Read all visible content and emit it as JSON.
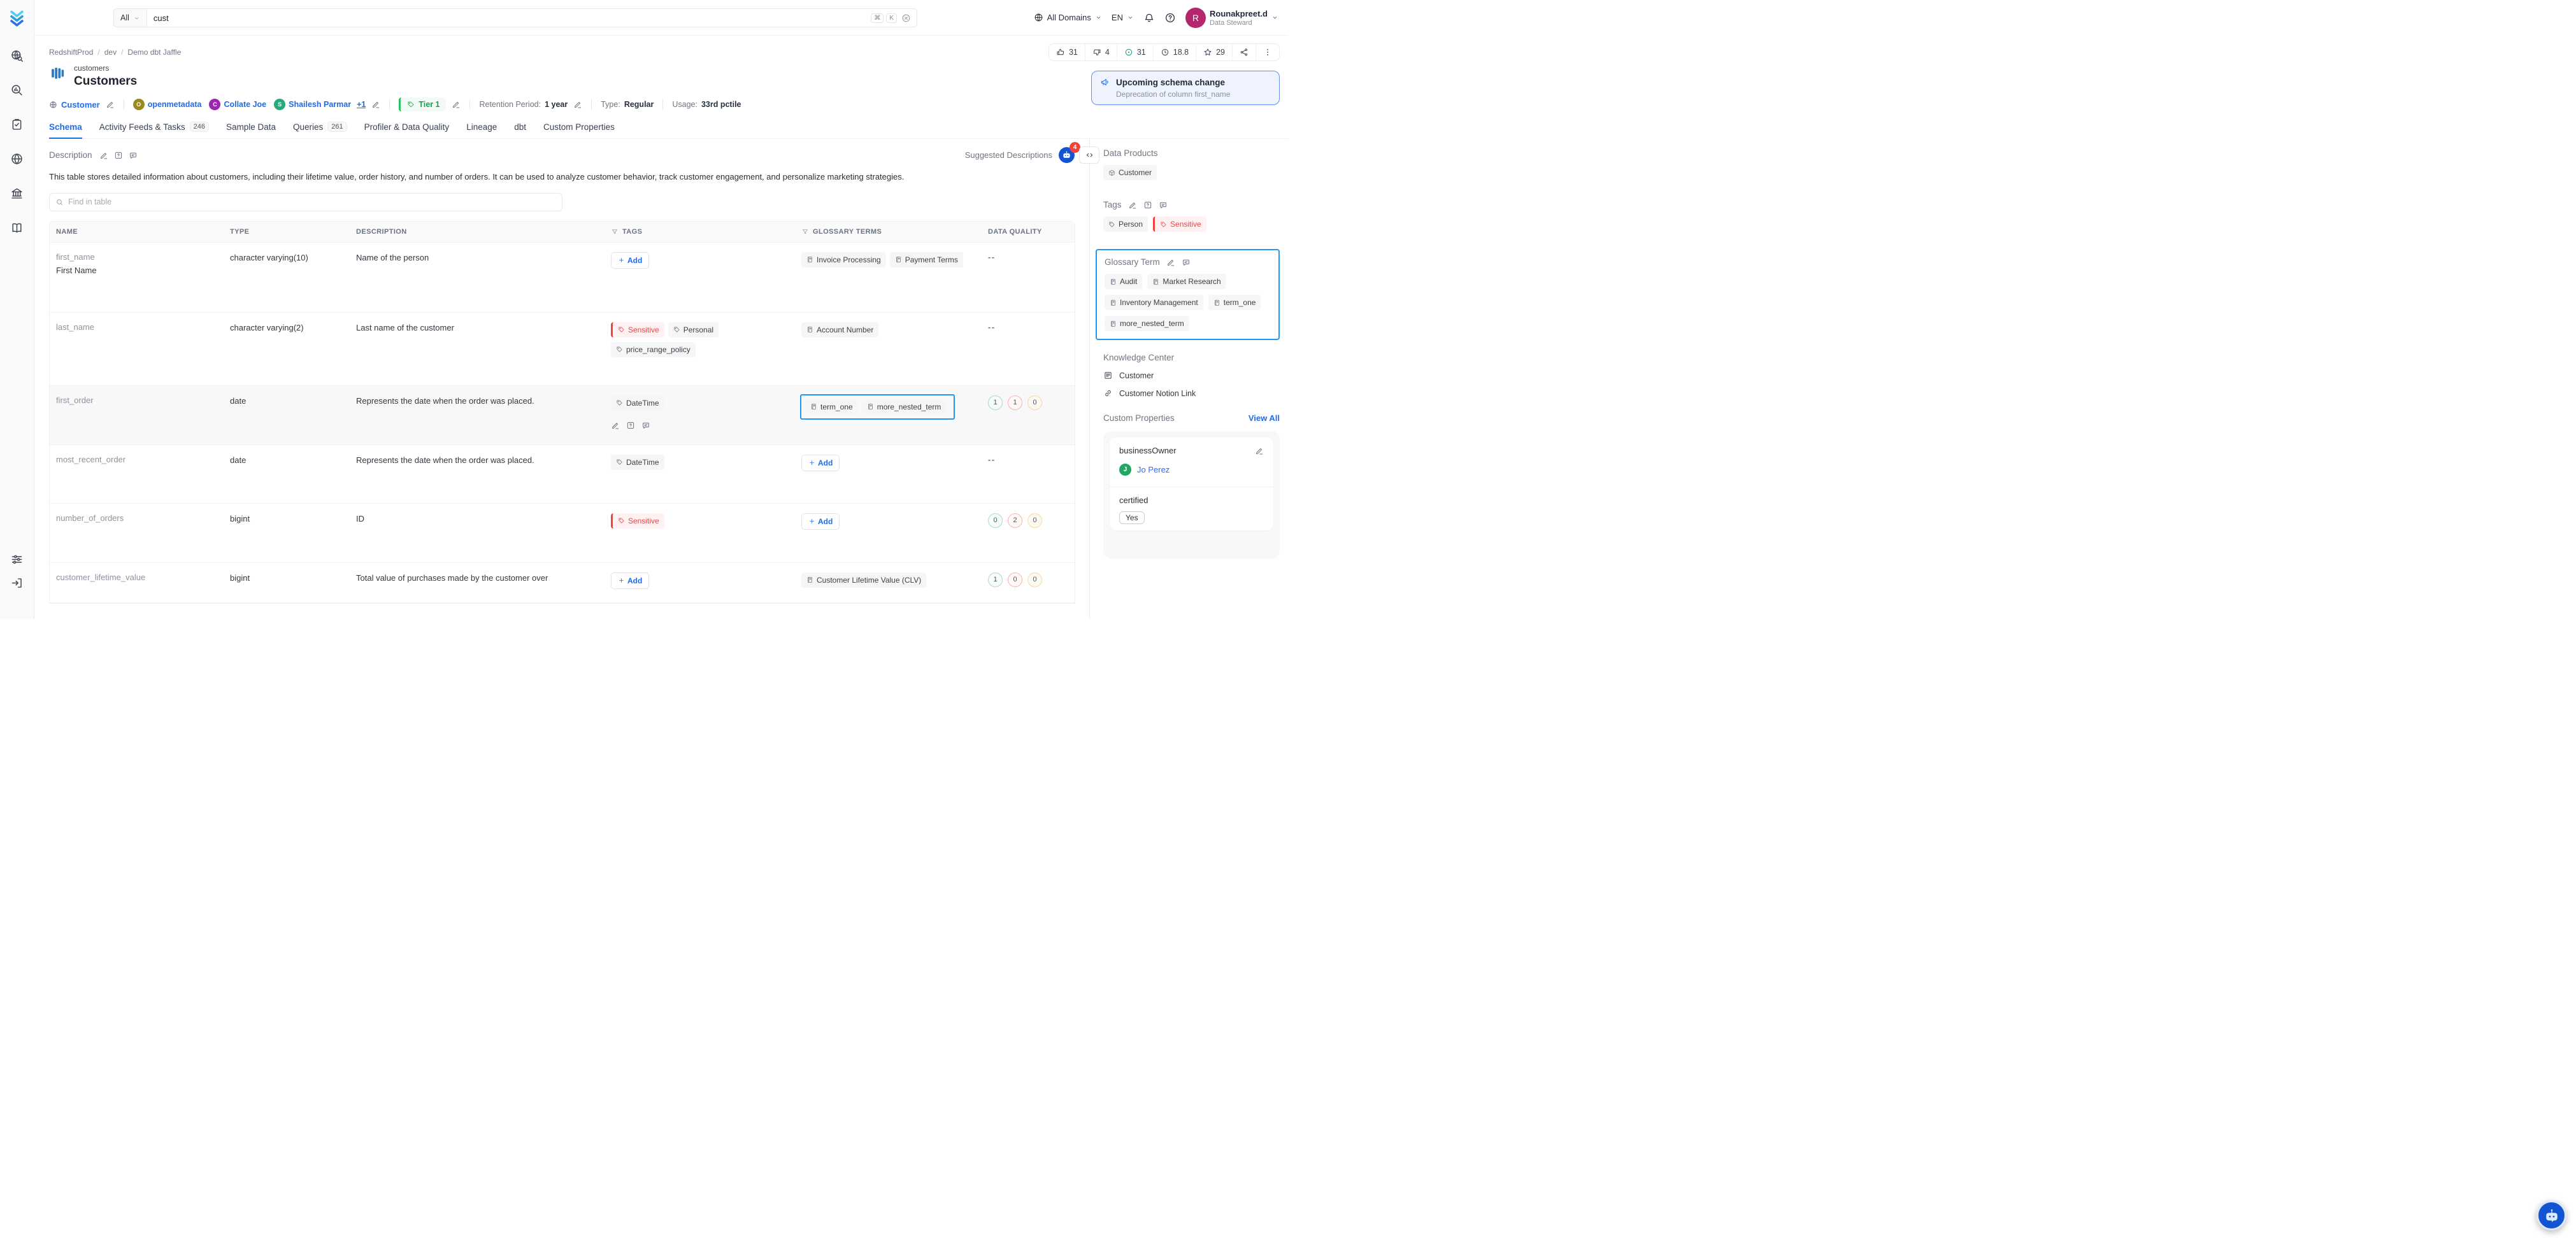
{
  "topbar": {
    "search": {
      "scope": "All",
      "value": "cust",
      "keys": [
        "⌘",
        "K"
      ]
    },
    "domain_selector": "All Domains",
    "language": "EN",
    "user": {
      "initial": "R",
      "name": "Rounakpreet.d",
      "role": "Data Steward"
    }
  },
  "leftnav": {
    "items": [
      "explore",
      "observability",
      "quality",
      "insights",
      "governance",
      "glossary"
    ],
    "bottom": [
      "settings",
      "logout"
    ]
  },
  "header": {
    "breadcrumb": [
      "RedshiftProd",
      "dev",
      "Demo dbt Jaffle"
    ],
    "entity_name": "customers",
    "entity_title": "Customers",
    "stats": [
      {
        "icon": "thumbs-up",
        "value": "31"
      },
      {
        "icon": "thumbs-down",
        "value": "4"
      },
      {
        "icon": "target",
        "value": "31",
        "accent": "teal"
      },
      {
        "icon": "clock",
        "value": "18.8"
      },
      {
        "icon": "star",
        "value": "29"
      },
      {
        "icon": "share"
      },
      {
        "icon": "more"
      }
    ],
    "meta": {
      "domain": "Customer",
      "owners": [
        {
          "initial": "O",
          "name": "openmetadata",
          "color": "#9a8a1d"
        },
        {
          "initial": "C",
          "name": "Collate Joe",
          "color": "#9b27af"
        },
        {
          "initial": "S",
          "name": "Shailesh Parmar",
          "color": "#2aa97c"
        }
      ],
      "owners_more": "+1",
      "tier": "Tier 1",
      "retention_label": "Retention Period:",
      "retention_value": "1 year",
      "type_label": "Type:",
      "type_value": "Regular",
      "usage_label": "Usage:",
      "usage_value": "33rd pctile"
    },
    "announcement": {
      "title": "Upcoming schema change",
      "subtitle": "Deprecation of column first_name"
    }
  },
  "tabs": [
    {
      "label": "Schema",
      "active": true
    },
    {
      "label": "Activity Feeds & Tasks",
      "badge": "246"
    },
    {
      "label": "Sample Data"
    },
    {
      "label": "Queries",
      "badge": "261"
    },
    {
      "label": "Profiler & Data Quality"
    },
    {
      "label": "Lineage"
    },
    {
      "label": "dbt"
    },
    {
      "label": "Custom Properties"
    }
  ],
  "schema": {
    "description_label": "Description",
    "description": "This table stores detailed information about customers, including their lifetime value, order history, and number of orders. It can be used to analyze customer behavior, track customer engagement, and personalize marketing strategies.",
    "suggested_label": "Suggested Descriptions",
    "suggested_count": "4",
    "code_toggle": "<>",
    "find_placeholder": "Find in table",
    "add_label": "Add",
    "empty_value": "--",
    "columns": [
      {
        "label": "NAME"
      },
      {
        "label": "TYPE"
      },
      {
        "label": "DESCRIPTION"
      },
      {
        "label": "TAGS",
        "filterable": true
      },
      {
        "label": "GLOSSARY TERMS",
        "filterable": true
      },
      {
        "label": "DATA QUALITY"
      }
    ],
    "rows": [
      {
        "name": "first_name",
        "display_name": "First Name",
        "type": "character varying(10)",
        "description": "Name of the person",
        "tags": {
          "add": true
        },
        "glossary": {
          "items": [
            {
              "label": "Invoice Processing"
            },
            {
              "label": "Payment Terms"
            }
          ]
        },
        "quality": "--"
      },
      {
        "name": "last_name",
        "type": "character varying(2)",
        "description": "Last name of the customer",
        "tags": {
          "items": [
            {
              "label": "Sensitive",
              "variant": "sensitive"
            },
            {
              "label": "Personal"
            },
            {
              "label": "price_range_policy"
            }
          ]
        },
        "glossary": {
          "items": [
            {
              "label": "Account Number"
            }
          ]
        },
        "quality": "--"
      },
      {
        "name": "first_order",
        "type": "date",
        "description": "Represents the date when the order was placed.",
        "hovered": true,
        "tags": {
          "items": [
            {
              "label": "DateTime"
            }
          ],
          "actions": true
        },
        "glossary": {
          "items": [
            {
              "label": "term_one"
            },
            {
              "label": "more_nested_term"
            }
          ],
          "highlighted": true
        },
        "quality": {
          "passed": "1",
          "failed": "1",
          "aborted": "0"
        }
      },
      {
        "name": "most_recent_order",
        "type": "date",
        "description": "Represents the date when the order was placed.",
        "tags": {
          "items": [
            {
              "label": "DateTime"
            }
          ]
        },
        "glossary": {
          "add": true
        },
        "quality": "--"
      },
      {
        "name": "number_of_orders",
        "type": "bigint",
        "description": "ID",
        "tags": {
          "items": [
            {
              "label": "Sensitive",
              "variant": "sensitive"
            }
          ]
        },
        "glossary": {
          "add": true
        },
        "quality": {
          "passed": "0",
          "failed": "2",
          "aborted": "0"
        }
      },
      {
        "name": "customer_lifetime_value",
        "type": "bigint",
        "description": "Total value of purchases made by the customer over",
        "tags": {
          "add": true
        },
        "glossary": {
          "items": [
            {
              "label": "Customer Lifetime Value (CLV)"
            }
          ]
        },
        "quality": {
          "passed": "1",
          "failed": "0",
          "aborted": "0"
        }
      }
    ]
  },
  "sidebar": {
    "data_products": {
      "title": "Data Products",
      "items": [
        {
          "label": "Customer"
        }
      ]
    },
    "tags": {
      "title": "Tags",
      "items": [
        {
          "label": "Person"
        },
        {
          "label": "Sensitive",
          "variant": "sensitive"
        }
      ]
    },
    "glossary": {
      "title": "Glossary Term",
      "highlighted": true,
      "items": [
        {
          "label": "Audit"
        },
        {
          "label": "Market Research"
        },
        {
          "label": "Inventory Management"
        },
        {
          "label": "term_one"
        },
        {
          "label": "more_nested_term"
        }
      ]
    },
    "knowledge": {
      "title": "Knowledge Center",
      "items": [
        {
          "icon": "article",
          "label": "Customer"
        },
        {
          "icon": "link",
          "label": "Customer Notion Link"
        }
      ]
    },
    "custom_properties": {
      "title": "Custom Properties",
      "view_all": "View All",
      "properties": [
        {
          "name": "businessOwner",
          "value": "Jo Perez",
          "avatar": {
            "initial": "J",
            "color": "#23a566"
          }
        },
        {
          "name": "certified",
          "value": "Yes"
        }
      ]
    }
  }
}
